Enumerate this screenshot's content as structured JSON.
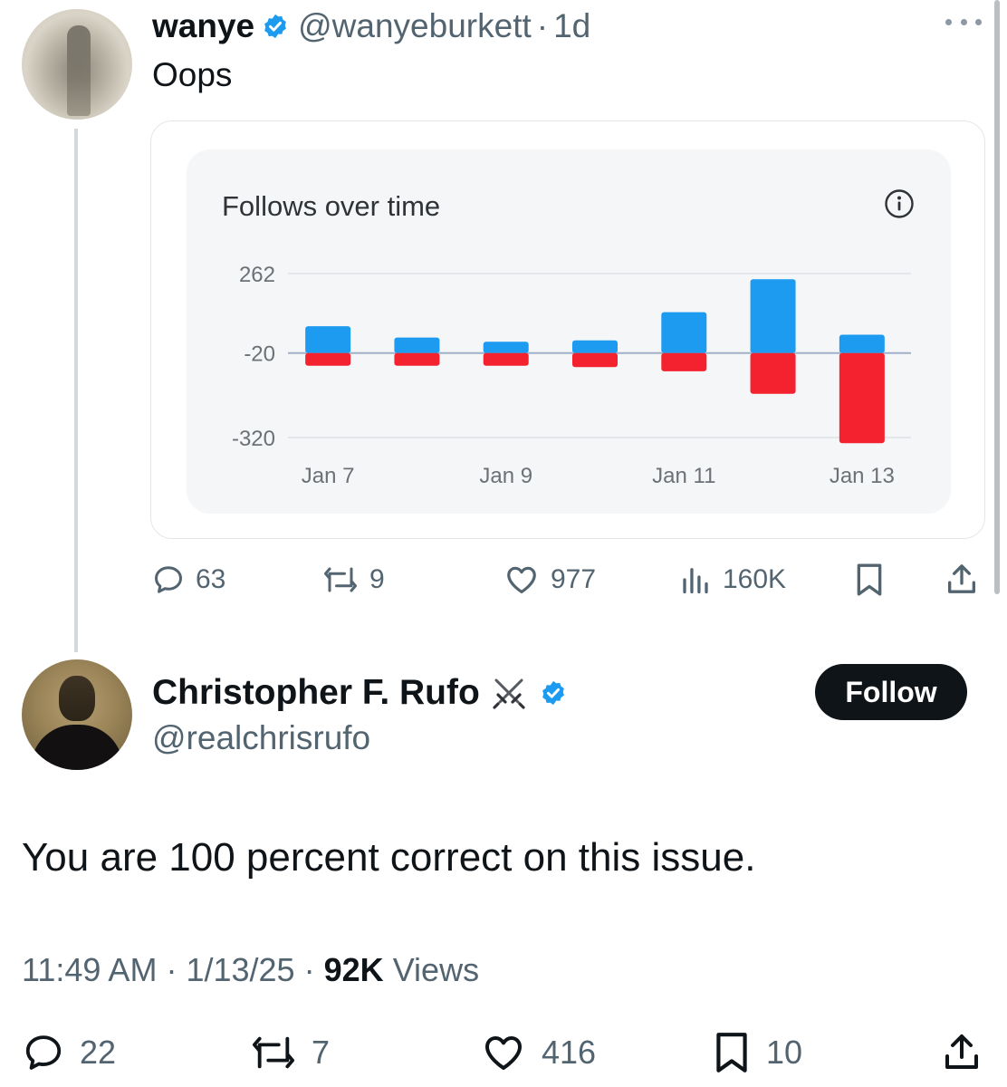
{
  "parent_tweet": {
    "author_name": "wanye",
    "handle": "@wanyeburkett",
    "separator": "·",
    "age": "1d",
    "text": "Oops",
    "actions": {
      "replies": "63",
      "reposts": "9",
      "likes": "977",
      "views": "160K"
    }
  },
  "embedded_chart": {
    "title": "Follows over time"
  },
  "chart_data": {
    "type": "bar",
    "title": "Follows over time",
    "xlabel": "",
    "ylabel": "",
    "y_ticks": [
      "262",
      "-20",
      "-320"
    ],
    "tick_values": [
      262,
      -20,
      -320
    ],
    "x_tick_labels": [
      "Jan 7",
      "Jan 9",
      "Jan 11",
      "Jan 13"
    ],
    "x_tick_positions": [
      0,
      2,
      4,
      6
    ],
    "ylim": [
      -320,
      262
    ],
    "grid": true,
    "stacked_diverging": true,
    "baseline": -20,
    "categories": [
      "Jan 7",
      "Jan 8",
      "Jan 9",
      "Jan 10",
      "Jan 11",
      "Jan 12",
      "Jan 13"
    ],
    "series": [
      {
        "color": "#1d9bf0",
        "values": [
          95,
          55,
          40,
          45,
          145,
          262,
          65
        ]
      },
      {
        "color": "#f4212e",
        "values": [
          -45,
          -45,
          -45,
          -50,
          -65,
          -145,
          -320
        ]
      }
    ]
  },
  "reply_tweet": {
    "author_name": "Christopher F. Rufo",
    "handle": "@realchrisrufo",
    "follow_label": "Follow",
    "text": "You are 100 percent correct on this issue.",
    "time": "11:49 AM",
    "date": "1/13/25",
    "separator": "·",
    "views_count": "92K",
    "views_label": "Views",
    "actions": {
      "replies": "22",
      "reposts": "7",
      "likes": "416",
      "bookmarks": "10"
    }
  },
  "colors": {
    "accent_blue": "#1d9bf0",
    "negative_red": "#f4212e",
    "text_primary": "#0f1419",
    "text_secondary": "#536471"
  },
  "icons": [
    "more-icon",
    "verified-badge-icon",
    "info-icon",
    "reply-icon",
    "repost-icon",
    "like-icon",
    "views-icon",
    "bookmark-icon",
    "share-icon",
    "crossed-swords-icon"
  ]
}
